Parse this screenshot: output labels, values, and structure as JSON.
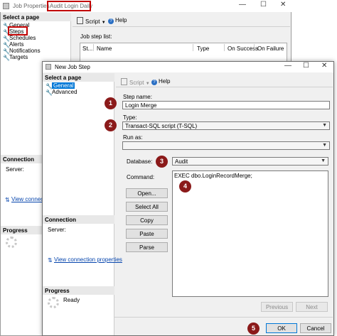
{
  "outer": {
    "title": "Job Properties",
    "title_highlight": "Audit Login Daily",
    "select_page": "Select a page",
    "pages": [
      "General",
      "Steps",
      "Schedules",
      "Alerts",
      "Notifications",
      "Targets"
    ],
    "toolbar": {
      "script": "Script",
      "help": "Help"
    },
    "step_list_label": "Job step list:",
    "columns": [
      "St...",
      "Name",
      "Type",
      "On Success",
      "On Failure"
    ],
    "connection_head": "Connection",
    "server_label": "Server:",
    "view_connection": "View connection",
    "progress_head": "Progress"
  },
  "dialog": {
    "title": "New Job Step",
    "select_page": "Select a page",
    "pages": [
      "General",
      "Advanced"
    ],
    "toolbar": {
      "script": "Script",
      "help": "Help"
    },
    "step_name_label": "Step name:",
    "step_name_value": "Login Merge",
    "type_label": "Type:",
    "type_value": "Transact-SQL script (T-SQL)",
    "run_as_label": "Run as:",
    "run_as_value": "",
    "database_label": "Database:",
    "database_value": "Audit",
    "command_label": "Command:",
    "command_value": "EXEC dbo.LoginRecordMerge;",
    "buttons": [
      "Open...",
      "Select All",
      "Copy",
      "Paste",
      "Parse"
    ],
    "connection_head": "Connection",
    "server_label": "Server:",
    "view_connection": "View connection properties",
    "progress_head": "Progress",
    "progress_status": "Ready",
    "previous": "Previous",
    "next": "Next",
    "ok": "OK",
    "cancel": "Cancel"
  },
  "badges": [
    "1",
    "2",
    "3",
    "4",
    "5"
  ],
  "colors": {
    "badge": "#8b1a1a",
    "highlight": "#c00000",
    "selected": "#0078d7"
  },
  "icons": [
    "wrench-icon",
    "script-icon",
    "help-icon",
    "minimize-icon",
    "maximize-icon",
    "close-icon",
    "connection-icon"
  ]
}
